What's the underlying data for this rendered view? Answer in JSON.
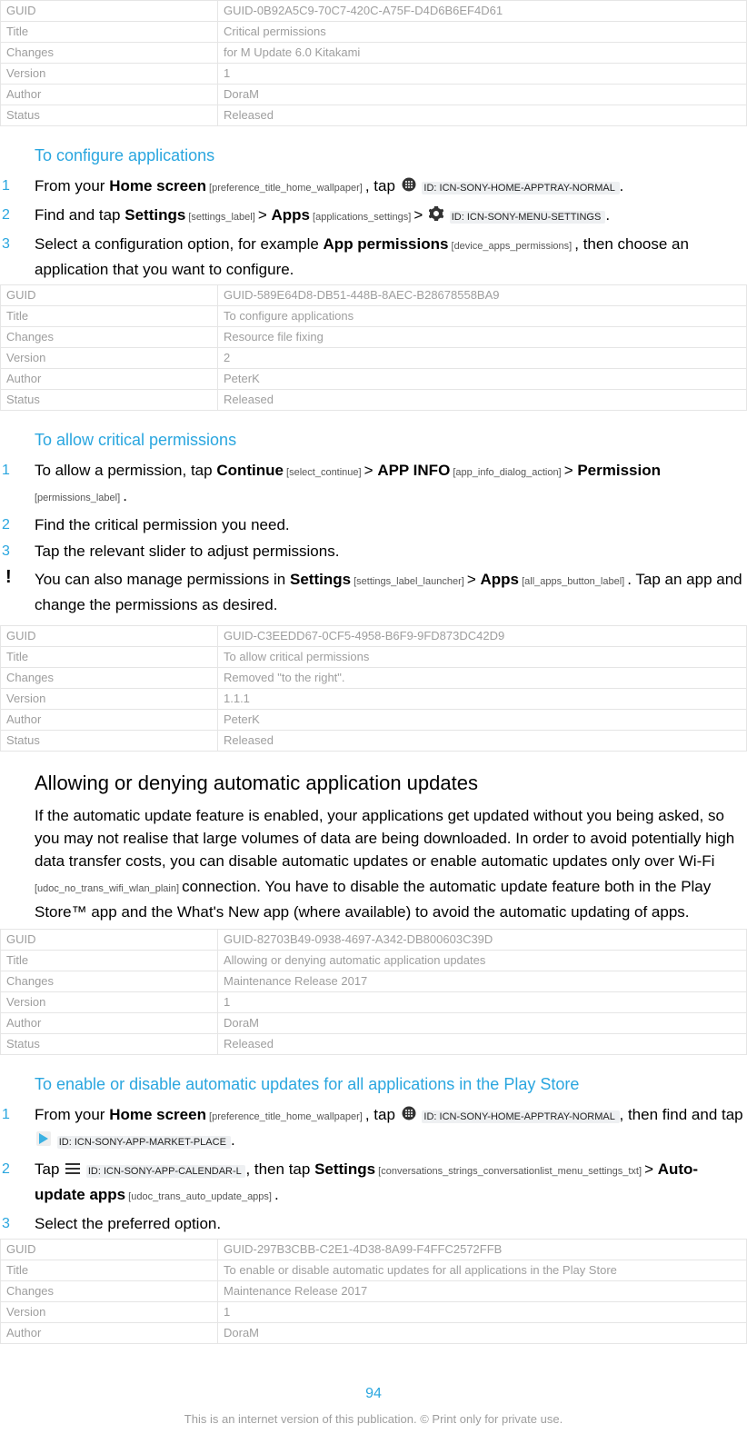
{
  "tables": {
    "t0": {
      "guid": "GUID-0B92A5C9-70C7-420C-A75F-D4D6B6EF4D61",
      "title": "Critical permissions",
      "changes": "for M Update 6.0 Kitakami",
      "version": "1",
      "author": "DoraM",
      "status": "Released"
    },
    "t1": {
      "guid": "GUID-589E64D8-DB51-448B-8AEC-B28678558BA9",
      "title": "To configure applications",
      "changes": "Resource file fixing",
      "version": "2",
      "author": "PeterK",
      "status": "Released"
    },
    "t2": {
      "guid": "GUID-C3EEDD67-0CF5-4958-B6F9-9FD873DC42D9",
      "title": "To allow critical permissions",
      "changes": "Removed \"to the right\".",
      "version": "1.1.1",
      "author": "PeterK",
      "status": "Released"
    },
    "t3": {
      "guid": "GUID-82703B49-0938-4697-A342-DB800603C39D",
      "title": "Allowing or denying automatic application updates",
      "changes": "Maintenance Release 2017",
      "version": "1",
      "author": "DoraM",
      "status": "Released"
    },
    "t4": {
      "guid": "GUID-297B3CBB-C2E1-4D38-8A99-F4FFC2572FFB",
      "title": "To enable or disable automatic updates for all applications in the Play Store",
      "changes": "Maintenance Release 2017",
      "version": "1",
      "author": "DoraM"
    }
  },
  "labels": {
    "guid": "GUID",
    "title": "Title",
    "changes": "Changes",
    "version": "Version",
    "author": "Author",
    "status": "Status"
  },
  "sections": {
    "s1": {
      "title": "To configure applications"
    },
    "s2": {
      "title": "To allow critical permissions"
    },
    "s3": {
      "title": "Allowing or denying automatic application updates"
    },
    "s4": {
      "title": "To enable or disable automatic updates for all applications in the Play Store"
    }
  },
  "text": {
    "s1_l1_a": "From your ",
    "s1_l1_home": "Home screen",
    "s1_l1_tag1": " [preference_title_home_wallpaper] ",
    "s1_l1_b": ", tap ",
    "s1_l1_iconid1": " ID: ICN-SONY-HOME-APPTRAY-NORMAL ",
    "s1_l1_c": ".",
    "s1_l2_a": "Find and tap ",
    "s1_l2_settings": "Settings",
    "s1_l2_tag1": " [settings_label] ",
    "s1_l2_gt1": "> ",
    "s1_l2_apps": "Apps",
    "s1_l2_tag2": " [applications_settings] ",
    "s1_l2_gt2": "> ",
    "s1_l2_iconid": " ID: ICN-SONY-MENU-SETTINGS ",
    "s1_l2_c": ".",
    "s1_l3_a": "Select a configuration option, for example ",
    "s1_l3_ap": "App permissions",
    "s1_l3_tag": " [device_apps_permissions] ",
    "s1_l3_b": ", then choose an application that you want to configure.",
    "s2_l1_a": "To allow a permission, tap ",
    "s2_l1_cont": "Continue",
    "s2_l1_tag1": " [select_continue] ",
    "gt": "> ",
    "s2_l1_appinfo": "APP INFO",
    "s2_l1_tag2": " [app_info_dialog_action] ",
    "s2_l1_perm": "Permission",
    "s2_l1_tag3": " [permissions_label] ",
    "dot": ".",
    "s2_l2": "Find the critical permission you need.",
    "s2_l3": "Tap the relevant slider to adjust permissions.",
    "s2_note_a": "You can also manage permissions in ",
    "s2_note_settings": "Settings",
    "s2_note_tag1": " [settings_label_launcher] ",
    "s2_note_apps": "Apps",
    "s2_note_tag2": " [all_apps_button_label] ",
    "s2_note_b": ". Tap an app and change the permissions as desired.",
    "s3_body_a": "If the automatic update feature is enabled, your applications get updated without you being asked, so you may not realise that large volumes of data are being downloaded. In order to avoid potentially high data transfer costs, you can disable automatic updates or enable automatic updates only over Wi-Fi",
    "s3_body_tag": " [udoc_no_trans_wifi_wlan_plain] ",
    "s3_body_b": "connection. You have to disable the automatic update feature both in the Play Store™ app and the What's New app (where available) to avoid the automatic updating of apps.",
    "s4_l1_a": "From your ",
    "s4_l1_home": "Home screen",
    "s4_l1_tag1": " [preference_title_home_wallpaper] ",
    "s4_l1_b": ", tap ",
    "s4_l1_iconid1": " ID: ICN-SONY-HOME-APPTRAY-NORMAL ",
    "s4_l1_c": ", then find and tap ",
    "s4_l1_iconid2": " ID: ICN-SONY-APP-MARKET-PLACE ",
    "s4_l1_d": ".",
    "s4_l2_a": "Tap ",
    "s4_l2_iconid1": " ID: ICN-SONY-APP-CALENDAR-L ",
    "s4_l2_b": ", then tap ",
    "s4_l2_settings": "Settings",
    "s4_l2_tag1": " [conversations_strings_conversationlist_menu_settings_txt] ",
    "s4_l2_auto": "Auto-update apps",
    "s4_l2_tag2": " [udoc_trans_auto_update_apps] ",
    "s4_l2_c": ".",
    "s4_l3": "Select the preferred option."
  },
  "footer": {
    "page": "94",
    "note": "This is an internet version of this publication. © Print only for private use."
  }
}
